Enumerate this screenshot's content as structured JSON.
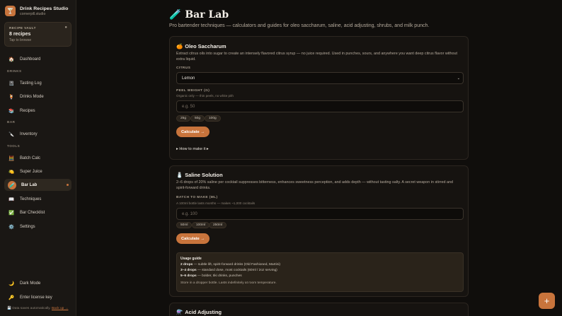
{
  "brand": {
    "logo": "🍸",
    "name": "Drink Recipes Studio",
    "sub": "cornerpill.studio"
  },
  "vault": {
    "label": "RECIPE VAULT",
    "count": "8 recipes",
    "hint": "Tap to browse",
    "icon": "●"
  },
  "nav": {
    "dashboard": {
      "icon": "🏠",
      "label": "Dashboard"
    },
    "drinks_section": "DRINKS",
    "tasting_log": {
      "icon": "📓",
      "label": "Tasting Log"
    },
    "drinks_mode": {
      "icon": "🍹",
      "label": "Drinks Mode"
    },
    "recipes": {
      "icon": "📚",
      "label": "Recipes"
    },
    "bar_section": "BAR",
    "inventory": {
      "icon": "🔪",
      "label": "Inventory"
    },
    "tools_section": "TOOLS",
    "batch_calc": {
      "icon": "🧮",
      "label": "Batch Calc"
    },
    "super_juice": {
      "icon": "🍋",
      "label": "Super Juice"
    },
    "bar_lab": {
      "icon": "🧪",
      "label": "Bar Lab"
    },
    "techniques": {
      "icon": "📖",
      "label": "Techniques"
    },
    "bar_checklist": {
      "icon": "✅",
      "label": "Bar Checklist"
    },
    "settings": {
      "icon": "⚙️",
      "label": "Settings"
    },
    "dark_mode": {
      "icon": "🌙",
      "label": "Dark Mode"
    },
    "license": {
      "icon": "🔑",
      "label": "Enter license key"
    }
  },
  "footer": {
    "icon": "💾",
    "text": "Data saves automatically.",
    "link": "Back up →"
  },
  "page": {
    "title_icon": "🧪",
    "title": "Bar Lab",
    "subtitle": "Pro bartender techniques — calculators and guides for oleo saccharum, saline, acid adjusting, shrubs, and milk punch."
  },
  "oleo": {
    "icon": "🍊",
    "title": "Oleo Saccharum",
    "desc": "Extract citrus oils into sugar to create an intensely flavored citrus syrup — no juice required. Used in punches, sours, and anywhere you want deep citrus flavor without extra liquid.",
    "citrus_label": "CITRUS",
    "citrus_value": "Lemon",
    "peel_label": "PEEL WEIGHT (G)",
    "peel_hint": "Organic only — thin peels, no white pith",
    "peel_placeholder": "e.g. 50",
    "chips": [
      "25g",
      "50g",
      "100g"
    ],
    "calc_label": "Calculate →",
    "howto_label": "▸ How to make it ▸"
  },
  "saline": {
    "icon": "🧂",
    "title": "Saline Solution",
    "desc": "2–6 drops of 20% saline per cocktail suppresses bitterness, enhances sweetness perception, and adds depth — without tasting salty. A secret weapon in stirred and spirit-forward drinks.",
    "batch_label": "BATCH TO MAKE (ML)",
    "batch_hint": "A 100ml bottle lasts months — makes ~1,000 cocktails",
    "batch_placeholder": "e.g. 100",
    "chips": [
      "50ml",
      "100ml",
      "250ml"
    ],
    "calc_label": "Calculate →",
    "guide": {
      "title": "Usage guide",
      "l1_b": "2 drops",
      "l1": " — subtle lift, spirit-forward drinks (Old Fashioned, Martini)",
      "l2_b": "3–4 drops",
      "l2": " — standard dose, most cocktails (60ml / 2oz serving)",
      "l3_b": "5–6 drops",
      "l3": " — bolder, tiki drinks, punches",
      "foot": "Store in a dropper bottle. Lasts indefinitely at room temperature."
    }
  },
  "acid": {
    "icon": "⚗️",
    "title": "Acid Adjusting"
  },
  "fab_icon": "+"
}
